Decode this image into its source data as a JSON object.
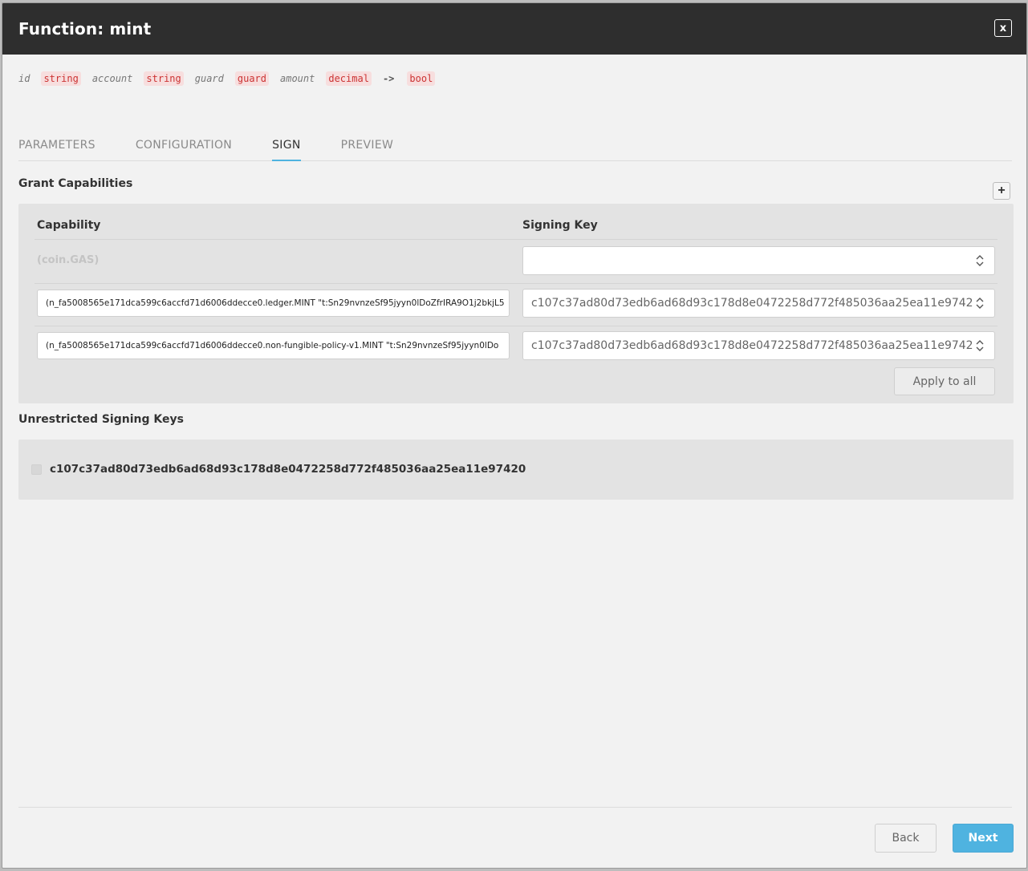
{
  "dialog": {
    "title": "Function: mint",
    "close_label": "x"
  },
  "signature": {
    "params": [
      {
        "name": "id",
        "type": "string"
      },
      {
        "name": "account",
        "type": "string"
      },
      {
        "name": "guard",
        "type": "guard"
      },
      {
        "name": "amount",
        "type": "decimal"
      }
    ],
    "arrow": "->",
    "return_type": "bool"
  },
  "tabs": [
    {
      "label": "PARAMETERS",
      "active": false
    },
    {
      "label": "CONFIGURATION",
      "active": false
    },
    {
      "label": "SIGN",
      "active": true
    },
    {
      "label": "PREVIEW",
      "active": false
    }
  ],
  "grant_capabilities": {
    "title": "Grant Capabilities",
    "add_label": "+",
    "headers": {
      "capability": "Capability",
      "signing_key": "Signing Key"
    },
    "rows": [
      {
        "capability": "(coin.GAS)",
        "signing_key": ""
      },
      {
        "capability": "(n_fa5008565e171dca599c6accfd71d6006ddecce0.ledger.MINT \"t:Sn29nvnzeSf95jyyn0lDoZfrIRA9O1j2bkjL5",
        "signing_key": "c107c37ad80d73edb6ad68d93c178d8e0472258d772f485036aa25ea11e9742"
      },
      {
        "capability": "(n_fa5008565e171dca599c6accfd71d6006ddecce0.non-fungible-policy-v1.MINT \"t:Sn29nvnzeSf95jyyn0lDo",
        "signing_key": "c107c37ad80d73edb6ad68d93c178d8e0472258d772f485036aa25ea11e9742"
      }
    ],
    "apply_label": "Apply to all"
  },
  "unrestricted": {
    "title": "Unrestricted Signing Keys",
    "key": "c107c37ad80d73edb6ad68d93c178d8e0472258d772f485036aa25ea11e97420"
  },
  "footer": {
    "back_label": "Back",
    "next_label": "Next"
  },
  "colors": {
    "titlebar": "#2e2e2e",
    "accent": "#4fb3e0",
    "type_text": "#cc3333"
  }
}
